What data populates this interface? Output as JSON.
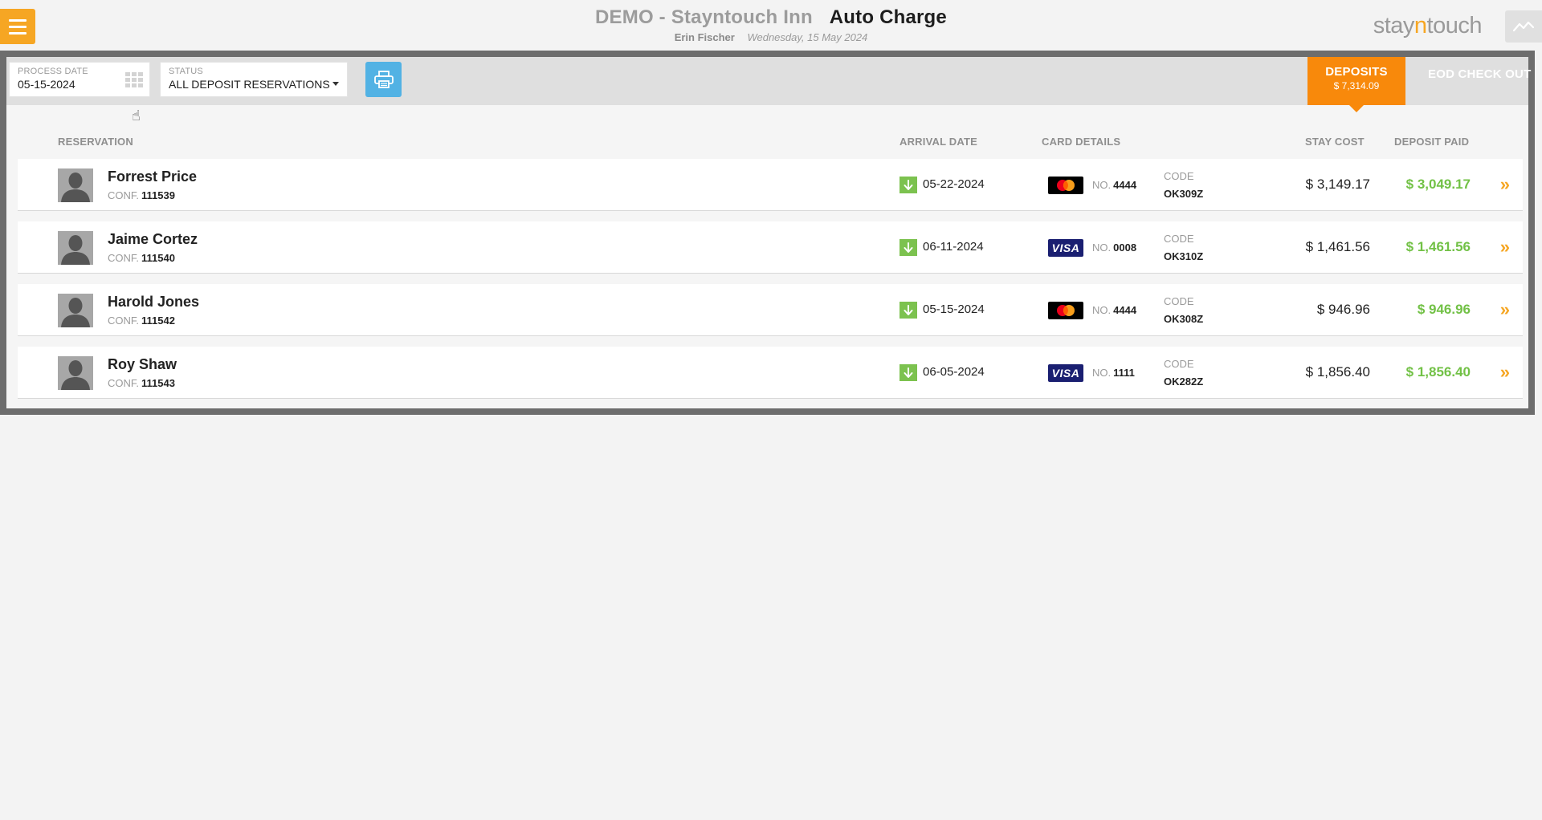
{
  "header": {
    "hotel": "DEMO - Stayntouch Inn",
    "page_title": "Auto Charge",
    "user": "Erin Fischer",
    "date": "Wednesday, 15 May 2024",
    "logo_pre": "stay",
    "logo_mid": "n",
    "logo_post": "touch"
  },
  "filters": {
    "process_date_label": "PROCESS DATE",
    "process_date_value": "05-15-2024",
    "status_label": "STATUS",
    "status_value": "ALL DEPOSIT RESERVATIONS"
  },
  "tabs": {
    "deposits_label": "DEPOSITS",
    "deposits_amount": "$ 7,314.09",
    "eod_label": "EOD CHECK OUT"
  },
  "columns": {
    "reservation": "RESERVATION",
    "arrival_date": "ARRIVAL DATE",
    "card_details": "CARD DETAILS",
    "stay_cost": "STAY COST",
    "deposit_paid": "DEPOSIT PAID"
  },
  "labels": {
    "conf": "CONF.",
    "no": "NO.",
    "code": "CODE"
  },
  "colors": {
    "accent": "#f6a623",
    "deposits_tab": "#f8890b",
    "paid_green": "#72c146",
    "arrival_green": "#7cc24f",
    "print_blue": "#52b2e4"
  },
  "reservations": [
    {
      "name": "Forrest Price",
      "conf": "111539",
      "arrival": "05-22-2024",
      "card_type": "mastercard",
      "card_label": "",
      "card_no": "4444",
      "code": "OK309Z",
      "stay_cost": "$ 3,149.17",
      "deposit_paid": "$ 3,049.17"
    },
    {
      "name": "Jaime Cortez",
      "conf": "111540",
      "arrival": "06-11-2024",
      "card_type": "visa",
      "card_label": "VISA",
      "card_no": "0008",
      "code": "OK310Z",
      "stay_cost": "$ 1,461.56",
      "deposit_paid": "$ 1,461.56"
    },
    {
      "name": "Harold Jones",
      "conf": "111542",
      "arrival": "05-15-2024",
      "card_type": "mastercard",
      "card_label": "",
      "card_no": "4444",
      "code": "OK308Z",
      "stay_cost": "$ 946.96",
      "deposit_paid": "$ 946.96"
    },
    {
      "name": "Roy Shaw",
      "conf": "111543",
      "arrival": "06-05-2024",
      "card_type": "visa",
      "card_label": "VISA",
      "card_no": "1111",
      "code": "OK282Z",
      "stay_cost": "$ 1,856.40",
      "deposit_paid": "$ 1,856.40"
    }
  ]
}
